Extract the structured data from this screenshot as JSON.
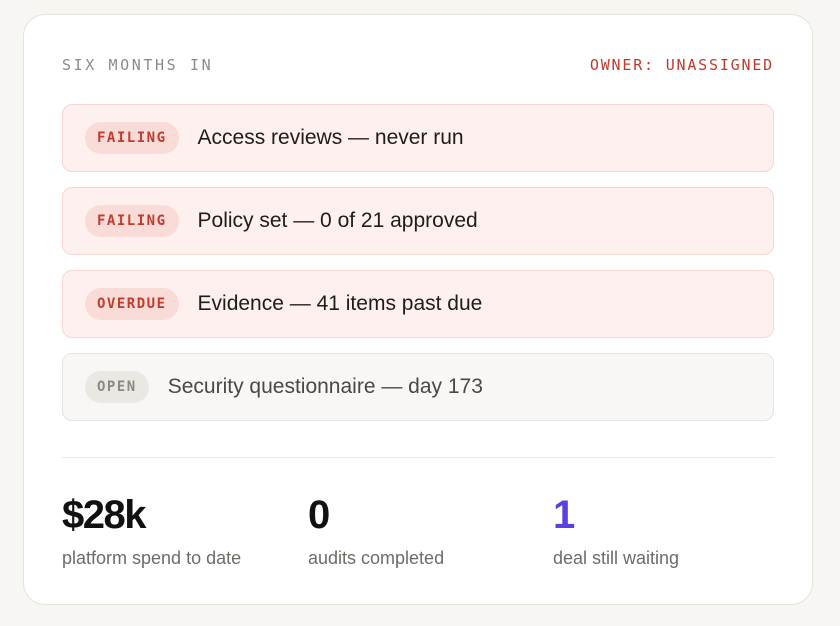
{
  "header": {
    "title": "SIX MONTHS IN",
    "owner": "OWNER: UNASSIGNED"
  },
  "items": [
    {
      "status": "FAILING",
      "text": "Access reviews — never run",
      "tone": "red"
    },
    {
      "status": "FAILING",
      "text": "Policy set — 0 of 21 approved",
      "tone": "red"
    },
    {
      "status": "OVERDUE",
      "text": "Evidence — 41 items past due",
      "tone": "red"
    },
    {
      "status": "OPEN",
      "text": "Security questionnaire — day 173",
      "tone": "gray"
    }
  ],
  "stats": [
    {
      "value": "$28k",
      "label": "platform spend to date"
    },
    {
      "value": "0",
      "label": "audits completed"
    },
    {
      "value": "1",
      "label": "deal still waiting"
    }
  ],
  "colors": {
    "alert": "#c13c2f",
    "accent": "#5b3fe0",
    "background": "#f8f6f3"
  }
}
